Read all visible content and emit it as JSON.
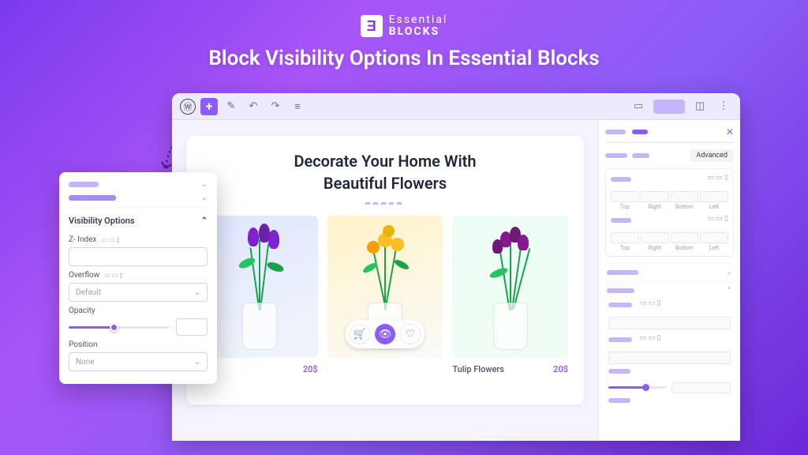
{
  "brand": {
    "mark": "Ǝ",
    "line1": "Essential",
    "line2": "BLOCKS"
  },
  "title": "Block Visibility Options In Essential Blocks",
  "canvas": {
    "heading_line1": "Decorate Your Home With",
    "heading_line2": "Beautiful Flowers"
  },
  "products": [
    {
      "name": "",
      "price": "20$"
    },
    {
      "name": "",
      "price": ""
    },
    {
      "name": "Tulip Flowers",
      "price": "20$"
    }
  ],
  "sidebar": {
    "tab_advanced": "Advanced",
    "spacing_labels": [
      "Top",
      "Right",
      "Bottom",
      "Left"
    ]
  },
  "panel": {
    "title": "Visibility Options",
    "zindex_label": "Z- Index",
    "overflow_label": "Overflow",
    "overflow_value": "Default",
    "opacity_label": "Opacity",
    "position_label": "Position",
    "position_value": "None"
  }
}
